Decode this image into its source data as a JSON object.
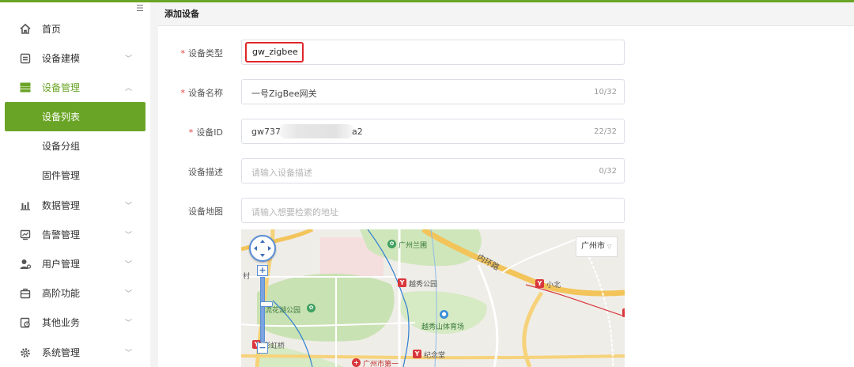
{
  "sidebar": {
    "collapse_icon": "collapse-icon",
    "items": [
      {
        "label": "首页",
        "icon": "home-icon"
      },
      {
        "label": "设备建模",
        "icon": "modeling-icon"
      },
      {
        "label": "设备管理",
        "icon": "device-management-icon",
        "expanded": true
      },
      {
        "label": "数据管理",
        "icon": "bar-chart-icon"
      },
      {
        "label": "告警管理",
        "icon": "alarm-icon"
      },
      {
        "label": "用户管理",
        "icon": "user-icon"
      },
      {
        "label": "高阶功能",
        "icon": "advanced-icon"
      },
      {
        "label": "其他业务",
        "icon": "other-business-icon"
      },
      {
        "label": "系统管理",
        "icon": "gear-icon"
      }
    ],
    "sub_items": [
      {
        "label": "设备列表",
        "selected": true
      },
      {
        "label": "设备分组"
      },
      {
        "label": "固件管理"
      }
    ]
  },
  "main": {
    "section_title": "添加设备",
    "form": {
      "device_type": {
        "label": "设备类型",
        "value": "gw_zigbee",
        "required": true
      },
      "device_name": {
        "label": "设备名称",
        "value": "一号ZigBee网关",
        "count": "10/32",
        "required": true
      },
      "device_id": {
        "label": "设备ID",
        "value_prefix": "gw737",
        "value_suffix": "a2",
        "count": "22/32",
        "required": true
      },
      "device_desc": {
        "label": "设备描述",
        "placeholder": "请输入设备描述",
        "count": "0/32"
      },
      "device_map": {
        "label": "设备地图",
        "placeholder": "请输入想要检索的地址"
      }
    },
    "map": {
      "city_select": "广州市",
      "zoom_in": "+",
      "zoom_out": "−",
      "labels": {
        "guangzhou_lanpu": "广州兰圃",
        "yuexiu_park": "越秀公园",
        "neihuan_road": "内环路",
        "xiaobei": "小北",
        "liuhuahu_park": "流花湖公园",
        "yuexiushan_stadium": "越秀山体育场",
        "caihong_bridge": "彩虹桥",
        "jinian_tang": "纪念堂",
        "guangzhou_shi_di_yi": "广州市第一",
        "village": "村"
      },
      "colors": {
        "accent": "#6aa426",
        "highlight": "#e0262a",
        "metro": "#d8373c",
        "park": "#c9e2b3",
        "road": "#f6d27a"
      }
    }
  }
}
